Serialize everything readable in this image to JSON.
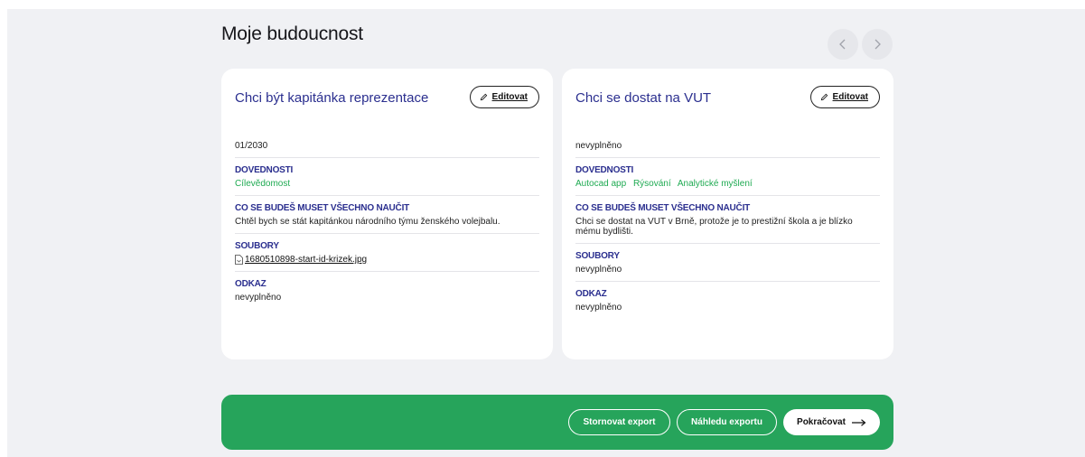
{
  "page": {
    "title": "Moje budoucnost"
  },
  "nav": {
    "prev_icon": "chevron-left-icon",
    "next_icon": "chevron-right-icon"
  },
  "cards": [
    {
      "title": "Chci být kapitánka reprezentace",
      "edit_label": "Editovat",
      "date": "01/2030",
      "skills_heading": "DOVEDNOSTI",
      "skills": [
        "Cílevědomost"
      ],
      "learn_heading": "CO SE BUDEŠ MUSET VŠECHNO NAUČIT",
      "learn_text": "Chtěl bych se stát kapitánkou národního týmu ženského volejbalu.",
      "files_heading": "SOUBORY",
      "file_name": "1680510898-start-id-krizek.jpg",
      "link_heading": "ODKAZ",
      "link_value": "nevyplněno"
    },
    {
      "title": "Chci se dostat na VUT",
      "edit_label": "Editovat",
      "date": "nevyplněno",
      "skills_heading": "DOVEDNOSTI",
      "skills": [
        "Autocad app",
        "Rýsování",
        "Analytické myšlení"
      ],
      "learn_heading": "CO SE BUDEŠ MUSET VŠECHNO NAUČIT",
      "learn_text": "Chci se dostat na VUT v Brně, protože je to prestižní škola a je blízko mému bydlišti.",
      "files_heading": "SOUBORY",
      "files_value": "nevyplněno",
      "link_heading": "ODKAZ",
      "link_value": "nevyplněno"
    }
  ],
  "footer": {
    "cancel_label": "Stornovat export",
    "preview_label": "Náhledu exportu",
    "continue_label": "Pokračovat",
    "continue_icon": "arrow-right-icon"
  },
  "colors": {
    "accent_green": "#26a45b",
    "heading_blue": "#2b2f8f",
    "skill_green": "#1faa52",
    "background": "#f0f1f4"
  }
}
